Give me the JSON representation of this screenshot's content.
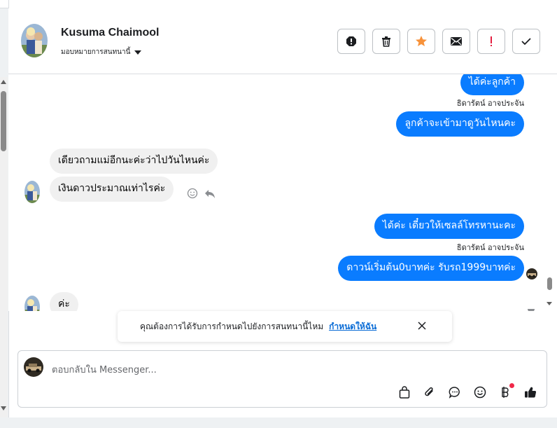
{
  "header": {
    "name": "Kusuma Chaimool",
    "assign_label": "มอบหมายการสนทนานี้",
    "actions": [
      "mark-spam",
      "delete",
      "star",
      "mark-unread",
      "important",
      "done"
    ]
  },
  "messages": [
    {
      "dir": "out",
      "text": "ได้ค่ะลูกค้า"
    },
    {
      "dir": "sender",
      "text": "ธิดารัตน์ อาจประจัน"
    },
    {
      "dir": "out",
      "text": "ลูกค้าจะเข้ามาดูวันไหนคะ"
    },
    {
      "dir": "in",
      "text": "เดียวถามแม่อีกนะค่ะว่าไปวันไหนค่ะ"
    },
    {
      "dir": "in",
      "text": "เงินดาวประมาณเท่าไรค่ะ"
    },
    {
      "dir": "out",
      "text": "ได้ค่ะ เดี๋ยวให้เซลล์โทรหานะคะ"
    },
    {
      "dir": "sender",
      "text": "ธิดารัตน์ อาจประจัน"
    },
    {
      "dir": "out",
      "text": "ดาวน์เริ่มต้น0บาทค่ะ รับรถ1999บาทค่ะ"
    },
    {
      "dir": "in",
      "text": "ค่ะ"
    }
  ],
  "notice": {
    "text": "คุณต้องการได้รับการกำหนดไปยังการสนทนานี้ไหม",
    "link": "กำหนดให้ฉัน"
  },
  "composer": {
    "placeholder": "ตอบกลับใน Messenger..."
  },
  "colors": {
    "accent": "#0a7cff",
    "incoming": "#f0f0f0",
    "star": "#f7923a",
    "important": "#e41e3f",
    "notify_dot": "#f02849"
  }
}
